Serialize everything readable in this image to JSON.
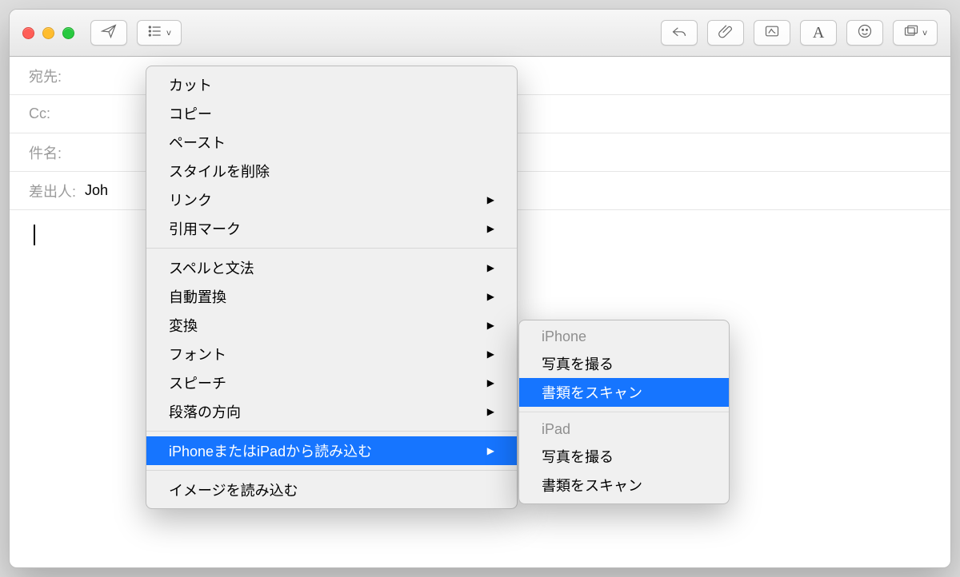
{
  "fields": {
    "to_label": "宛先:",
    "cc_label": "Cc:",
    "subject_label": "件名:",
    "from_label": "差出人:",
    "from_value": "Joh"
  },
  "context_menu": {
    "group_edit": {
      "cut": "カット",
      "copy": "コピー",
      "paste": "ペースト",
      "remove_style": "スタイルを削除",
      "link": "リンク",
      "quote_mark": "引用マーク"
    },
    "group_text": {
      "spelling": "スペルと文法",
      "auto_sub": "自動置換",
      "henkan": "変換",
      "font": "フォント",
      "speech": "スピーチ",
      "paragraph_dir": "段落の方向"
    },
    "import_device": "iPhoneまたはiPadから読み込む",
    "import_image": "イメージを読み込む"
  },
  "submenu": {
    "iphone_header": "iPhone",
    "take_photo": "写真を撮る",
    "scan_docs": "書類をスキャン",
    "ipad_header": "iPad"
  }
}
